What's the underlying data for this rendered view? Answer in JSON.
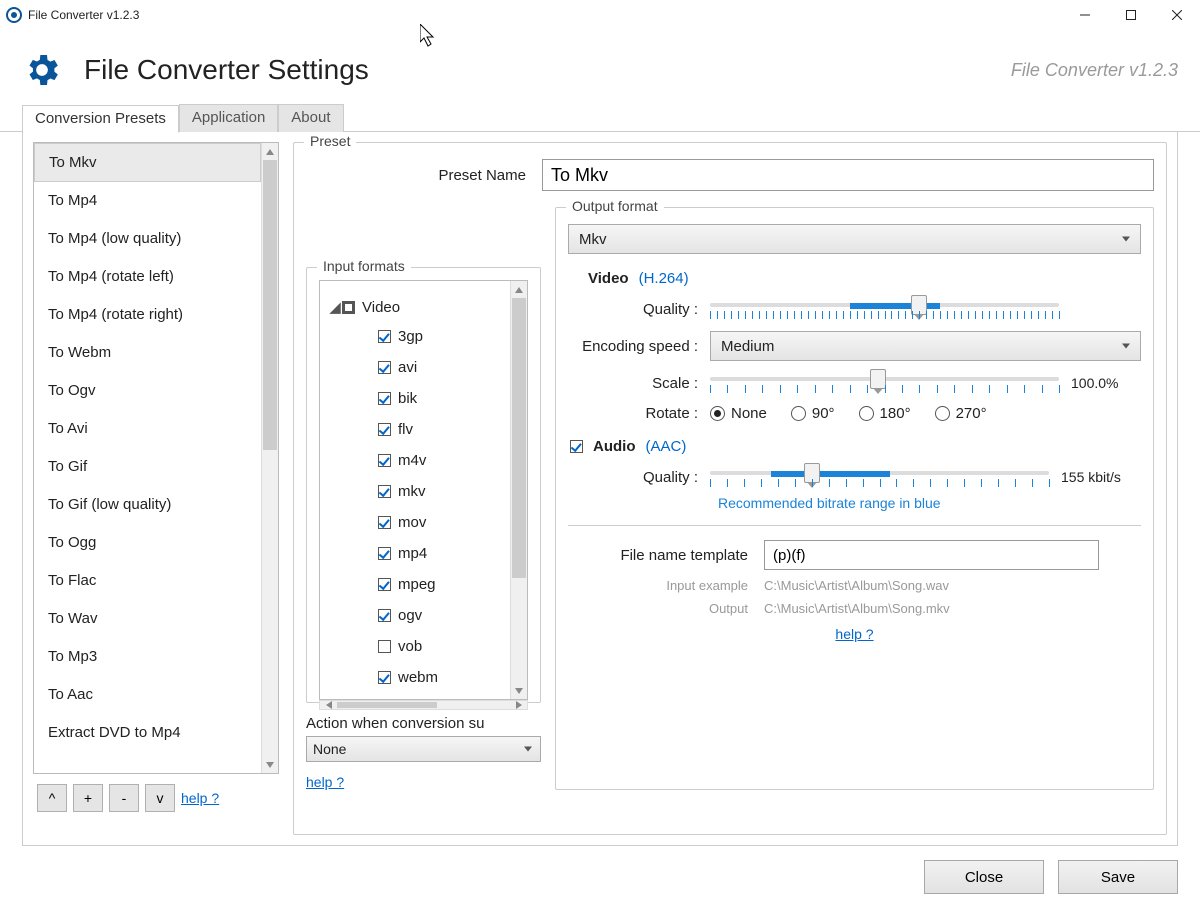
{
  "window": {
    "title": "File Converter v1.2.3"
  },
  "header": {
    "title": "File Converter Settings",
    "version_label": "File Converter v1.2.3"
  },
  "tabs": {
    "presets": "Conversion Presets",
    "application": "Application",
    "about": "About"
  },
  "preset_list": {
    "items": [
      "To Mkv",
      "To Mp4",
      "To Mp4 (low quality)",
      "To Mp4 (rotate left)",
      "To Mp4 (rotate right)",
      "To Webm",
      "To Ogv",
      "To Avi",
      "To Gif",
      "To Gif (low quality)",
      "To Ogg",
      "To Flac",
      "To Wav",
      "To Mp3",
      "To Aac",
      "Extract DVD to Mp4"
    ],
    "selected": "To Mkv",
    "move_up": "^",
    "add": "+",
    "remove": "-",
    "move_down": "v",
    "help": "help ?"
  },
  "preset_panel": {
    "legend": "Preset",
    "name_label": "Preset Name",
    "name_value": "To Mkv"
  },
  "input_formats": {
    "legend": "Input formats",
    "group_label": "Video",
    "items": [
      {
        "name": "3gp",
        "checked": true
      },
      {
        "name": "avi",
        "checked": true
      },
      {
        "name": "bik",
        "checked": true
      },
      {
        "name": "flv",
        "checked": true
      },
      {
        "name": "m4v",
        "checked": true
      },
      {
        "name": "mkv",
        "checked": true
      },
      {
        "name": "mov",
        "checked": true
      },
      {
        "name": "mp4",
        "checked": true
      },
      {
        "name": "mpeg",
        "checked": true
      },
      {
        "name": "ogv",
        "checked": true
      },
      {
        "name": "vob",
        "checked": false
      },
      {
        "name": "webm",
        "checked": true
      }
    ],
    "action_label": "Action when conversion su",
    "action_value": "None",
    "help": "help ?"
  },
  "output": {
    "legend": "Output format",
    "format_value": "Mkv",
    "video": {
      "title": "Video",
      "codec": "(H.264)",
      "quality_label": "Quality :",
      "encoding_label": "Encoding speed :",
      "encoding_value": "Medium",
      "scale_label": "Scale :",
      "scale_value": "100.0%",
      "rotate_label": "Rotate :",
      "rotate_options": [
        "None",
        "90°",
        "180°",
        "270°"
      ],
      "rotate_selected": "None"
    },
    "audio": {
      "enabled": true,
      "title": "Audio",
      "codec": "(AAC)",
      "quality_label": "Quality :",
      "quality_value": "155 kbit/s",
      "recommendation": "Recommended bitrate range in blue"
    },
    "template": {
      "label": "File name template",
      "value": "(p)(f)",
      "input_example_label": "Input example",
      "input_example_value": "C:\\Music\\Artist\\Album\\Song.wav",
      "output_label": "Output",
      "output_value": "C:\\Music\\Artist\\Album\\Song.mkv",
      "help": "help ?"
    }
  },
  "footer": {
    "close": "Close",
    "save": "Save"
  }
}
